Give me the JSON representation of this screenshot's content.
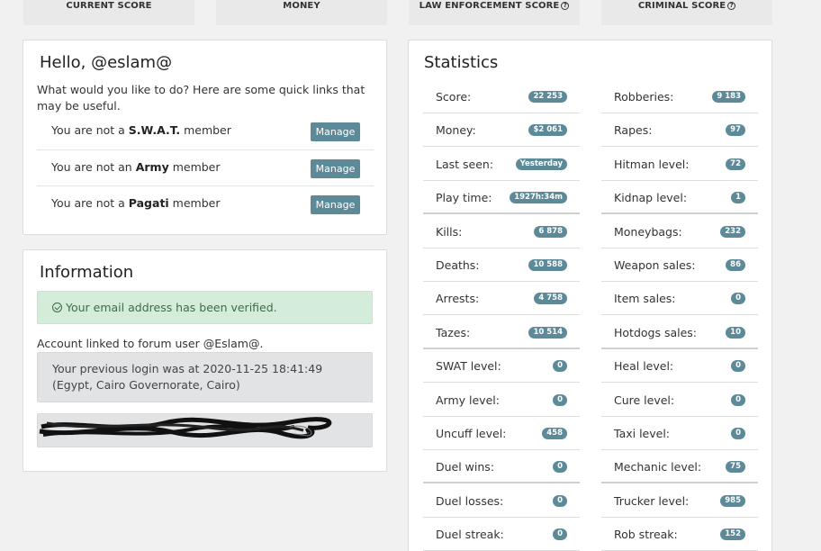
{
  "top_tabs": [
    {
      "label": "CURRENT SCORE",
      "help": false
    },
    {
      "label": "MONEY",
      "help": false
    },
    {
      "label": "LAW ENFORCEMENT SCORE",
      "help": true
    },
    {
      "label": "CRIMINAL SCORE",
      "help": true
    }
  ],
  "hello": {
    "title": "Hello, @eslam@",
    "subtitle": "What would you like to do? Here are some quick links that may be useful.",
    "members": [
      {
        "prefix": "You are not a ",
        "group": "S.W.A.T.",
        "suffix": " member",
        "button": "Manage"
      },
      {
        "prefix": "You are not an ",
        "group": "Army",
        "suffix": " member",
        "button": "Manage"
      },
      {
        "prefix": "You are not a ",
        "group": "Pagati",
        "suffix": " member",
        "button": "Manage"
      }
    ]
  },
  "information": {
    "title": "Information",
    "verified": "Your email address has been verified.",
    "linked": "Account linked to forum user @Eslam@.",
    "last_login": "Your previous login was at 2020-11-25 18:41:49 (Egypt, Cairo Governorate, Cairo)"
  },
  "statistics": {
    "title": "Statistics",
    "left": [
      {
        "label": "Score:",
        "value": "22 253"
      },
      {
        "label": "Money:",
        "value": "$2 061"
      },
      {
        "label": "Last seen:",
        "value": "Yesterday"
      },
      {
        "label": "Play time:",
        "value": "1927h:34m"
      },
      {
        "label": "Kills:",
        "value": "6 878"
      },
      {
        "label": "Deaths:",
        "value": "10 588"
      },
      {
        "label": "Arrests:",
        "value": "4 758"
      },
      {
        "label": "Tazes:",
        "value": "10 514"
      },
      {
        "label": "SWAT level:",
        "value": "0"
      },
      {
        "label": "Army level:",
        "value": "0"
      },
      {
        "label": "Uncuff level:",
        "value": "458"
      },
      {
        "label": "Duel wins:",
        "value": "0"
      },
      {
        "label": "Duel losses:",
        "value": "0"
      },
      {
        "label": "Duel streak:",
        "value": "0"
      }
    ],
    "right": [
      {
        "label": "Robberies:",
        "value": "9 183"
      },
      {
        "label": "Rapes:",
        "value": "97"
      },
      {
        "label": "Hitman level:",
        "value": "72"
      },
      {
        "label": "Kidnap level:",
        "value": "1"
      },
      {
        "label": "Moneybags:",
        "value": "232"
      },
      {
        "label": "Weapon sales:",
        "value": "86"
      },
      {
        "label": "Item sales:",
        "value": "0"
      },
      {
        "label": "Hotdogs sales:",
        "value": "10"
      },
      {
        "label": "Heal level:",
        "value": "0"
      },
      {
        "label": "Cure level:",
        "value": "0"
      },
      {
        "label": "Taxi level:",
        "value": "0"
      },
      {
        "label": "Mechanic level:",
        "value": "75"
      },
      {
        "label": "Trucker level:",
        "value": "985"
      },
      {
        "label": "Rob streak:",
        "value": "152"
      }
    ]
  }
}
